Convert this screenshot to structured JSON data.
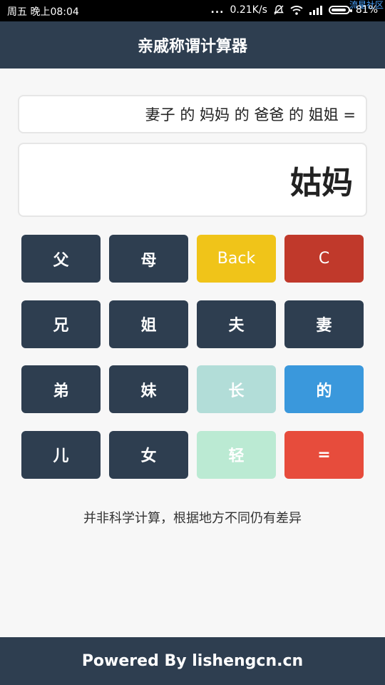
{
  "statusbar": {
    "time": "周五 晚上08:04",
    "dots": "...",
    "speed": "0.21K/s",
    "battery": "81%",
    "watermark": "流星社区"
  },
  "app": {
    "title": "亲戚称谓计算器"
  },
  "display": {
    "expression": "妻子 的 妈妈 的 爸爸 的 姐姐 =",
    "result": "姑妈"
  },
  "keys": {
    "father": "父",
    "mother": "母",
    "back": "Back",
    "clear": "C",
    "elder_brother": "兄",
    "elder_sister": "姐",
    "husband": "夫",
    "wife": "妻",
    "younger_brother": "弟",
    "younger_sister": "妹",
    "older": "长",
    "of": "的",
    "son": "儿",
    "daughter": "女",
    "younger": "轻",
    "equals": "="
  },
  "note": "并非科学计算，根据地方不同仍有差异",
  "footer": "Powered By lishengcn.cn",
  "colors": {
    "primary": "#2e3e50",
    "back": "#f0c419",
    "clear": "#c0392b",
    "older": "#b2ddd8",
    "of": "#3a98dc",
    "younger": "#bbead3",
    "equals": "#e74c3c"
  }
}
